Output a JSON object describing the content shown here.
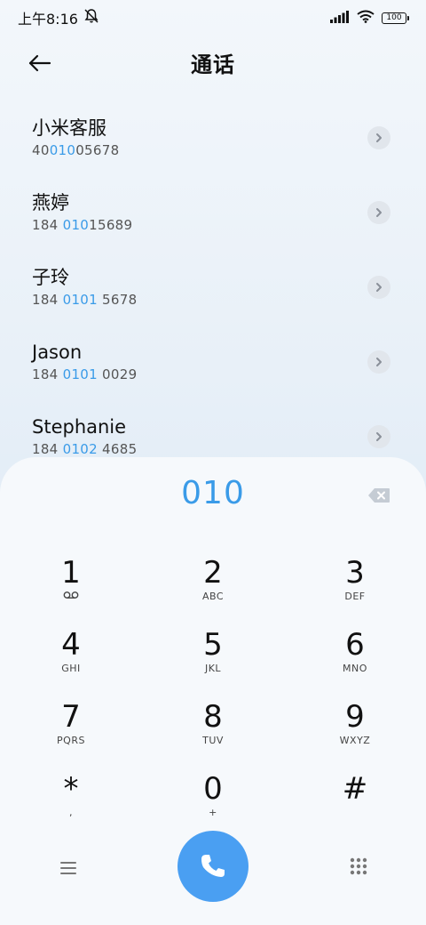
{
  "status_bar": {
    "time": "上午8:16",
    "battery": "100"
  },
  "header": {
    "title": "通话"
  },
  "contacts": [
    {
      "name": "小米客服",
      "num_prefix": "40",
      "num_match": "010",
      "num_suffix": "05678"
    },
    {
      "name": "燕婷",
      "num_prefix": "184 ",
      "num_match": "010",
      "num_suffix": "15689"
    },
    {
      "name": "子玲",
      "num_prefix": "184 ",
      "num_match": "0101",
      "num_suffix": " 5678"
    },
    {
      "name": "Jason",
      "num_prefix": "184 ",
      "num_match": "0101",
      "num_suffix": " 0029"
    },
    {
      "name": "Stephanie",
      "num_prefix": "184 ",
      "num_match": "0102",
      "num_suffix": " 4685"
    }
  ],
  "dialpad": {
    "input": "010",
    "keys": [
      {
        "digit": "1",
        "sub": ""
      },
      {
        "digit": "2",
        "sub": "ABC"
      },
      {
        "digit": "3",
        "sub": "DEF"
      },
      {
        "digit": "4",
        "sub": "GHI"
      },
      {
        "digit": "5",
        "sub": "JKL"
      },
      {
        "digit": "6",
        "sub": "MNO"
      },
      {
        "digit": "7",
        "sub": "PQRS"
      },
      {
        "digit": "8",
        "sub": "TUV"
      },
      {
        "digit": "9",
        "sub": "WXYZ"
      },
      {
        "digit": "*",
        "sub": ","
      },
      {
        "digit": "0",
        "sub": "+"
      },
      {
        "digit": "#",
        "sub": ""
      }
    ]
  },
  "icons": {
    "back": "back-arrow-icon",
    "mute": "bell-off-icon",
    "signal": "signal-icon",
    "wifi": "wifi-icon",
    "voicemail": "voicemail-icon",
    "delete": "backspace-icon",
    "menu": "menu-icon",
    "call": "phone-icon",
    "keypad": "keypad-icon"
  },
  "colors": {
    "accent": "#3a9be8",
    "call_button": "#4a9ff2"
  }
}
